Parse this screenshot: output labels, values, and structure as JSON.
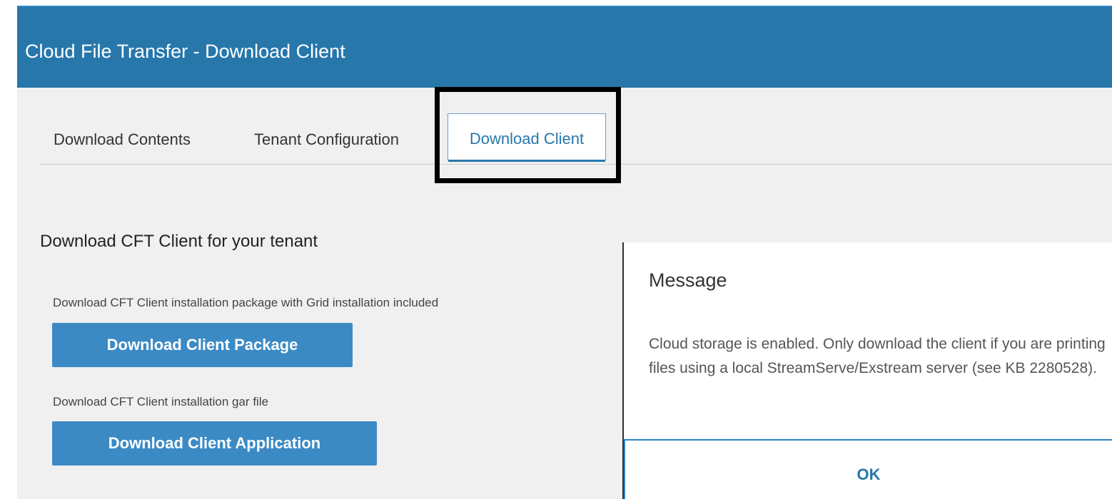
{
  "app": {
    "title": "Cloud File Transfer - Download Client"
  },
  "tabs": [
    {
      "label": "Download Contents"
    },
    {
      "label": "Tenant Configuration"
    },
    {
      "label": "Download Client"
    }
  ],
  "main": {
    "section_title": "Download CFT Client for your tenant",
    "items": [
      {
        "description": "Download CFT Client installation package with Grid installation included",
        "button_label": "Download Client Package"
      },
      {
        "description": "Download CFT Client installation gar file",
        "button_label": "Download Client Application"
      }
    ]
  },
  "dialog": {
    "title": "Message",
    "message": "Cloud storage is enabled. Only download the client if you are printing files using a local StreamServe/Exstream server (see KB 2280528).",
    "ok_label": "OK"
  },
  "colors": {
    "header_bg": "#2777ab",
    "button_bg": "#3b8ac4",
    "content_bg": "#f0f0f0",
    "highlight_border": "#000000"
  }
}
